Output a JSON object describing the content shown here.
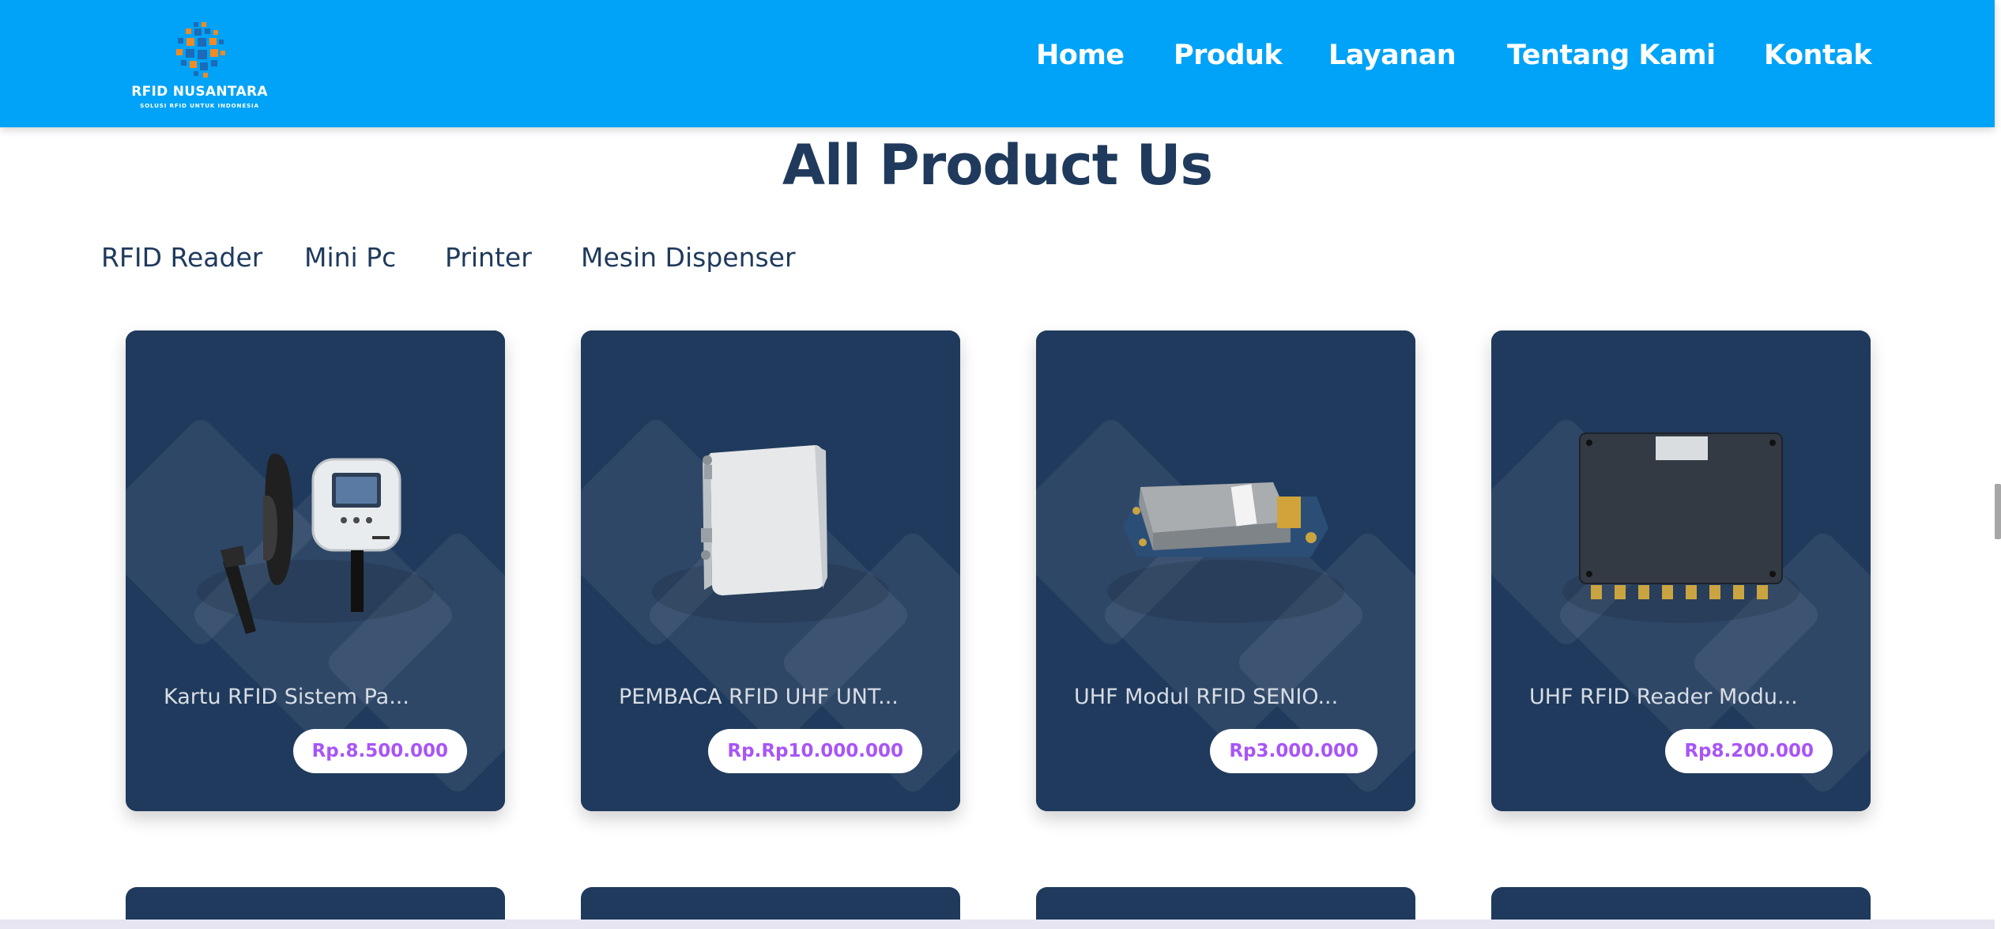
{
  "brand": {
    "name": "RFID NUSANTARA",
    "tagline": "SOLUSI RFID UNTUK INDONESIA",
    "colors": {
      "header": "#00a3f7",
      "navy": "#1f3a5c",
      "price": "#a855f7",
      "logo_blue": "#1b6bb8",
      "logo_orange": "#f08a24"
    }
  },
  "nav": {
    "items": [
      {
        "label": "Home"
      },
      {
        "label": "Produk"
      },
      {
        "label": "Layanan"
      },
      {
        "label": "Tentang Kami"
      },
      {
        "label": "Kontak"
      }
    ]
  },
  "page": {
    "title": "All Product Us"
  },
  "categories": [
    {
      "label": "RFID Reader"
    },
    {
      "label": "Mini Pc"
    },
    {
      "label": "Printer"
    },
    {
      "label": "Mesin Dispenser"
    }
  ],
  "products": [
    {
      "name": "Kartu RFID Sistem Pa...",
      "price": "Rp.8.500.000",
      "image": "parking-reader-image"
    },
    {
      "name": "PEMBACA RFID UHF UNT...",
      "price": "Rp.Rp10.000.000",
      "image": "uhf-antenna-reader-image"
    },
    {
      "name": "UHF Modul RFID SENIO...",
      "price": "Rp3.000.000",
      "image": "uhf-module-image"
    },
    {
      "name": "UHF RFID Reader Modu...",
      "price": "Rp8.200.000",
      "image": "uhf-reader-module-image"
    }
  ]
}
